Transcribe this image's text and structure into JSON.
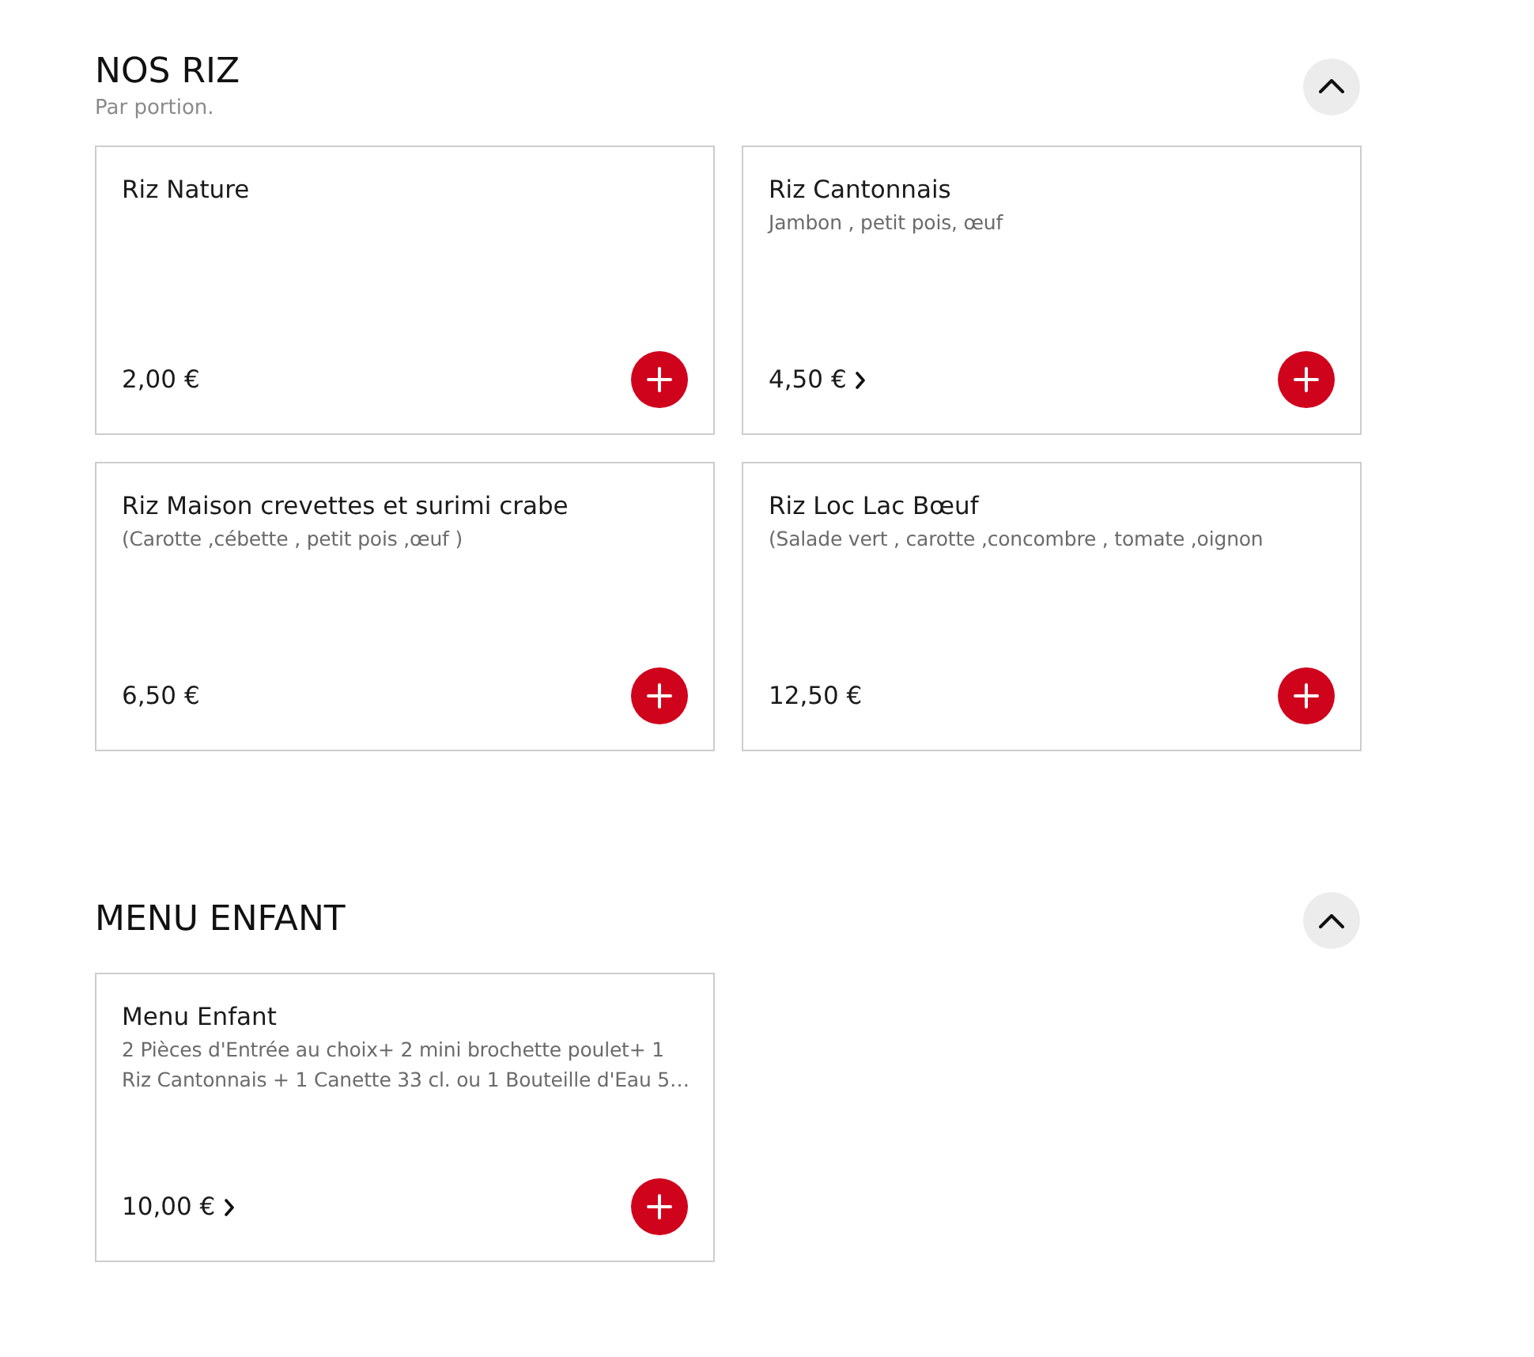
{
  "sections": [
    {
      "title": "NOS RIZ",
      "subtitle": "Par portion.",
      "expanded": true,
      "items": [
        {
          "name": "Riz Nature",
          "price": "2,00 €",
          "has_options": false
        },
        {
          "name": "Riz Cantonnais",
          "description": "Jambon , petit pois, œuf",
          "price": "4,50 €",
          "has_options": true
        },
        {
          "name": "Riz Maison crevettes et surimi crabe",
          "description": "(Carotte ,cébette , petit pois ,œuf )",
          "price": "6,50 €",
          "has_options": false
        },
        {
          "name": "Riz Loc Lac Bœuf",
          "description": "(Salade vert , carotte ,concombre , tomate ,oignon",
          "price": "12,50 €",
          "has_options": false
        }
      ]
    },
    {
      "title": "MENU ENFANT",
      "expanded": true,
      "items": [
        {
          "name": "Menu Enfant",
          "description": "2 Pièces d'Entrée au choix+ 2 mini brochette poulet+ 1 Riz Cantonnais + 1 Canette 33 cl. ou 1 Bouteille d'Eau 5…",
          "price": "10,00 €",
          "has_options": true
        }
      ]
    }
  ]
}
